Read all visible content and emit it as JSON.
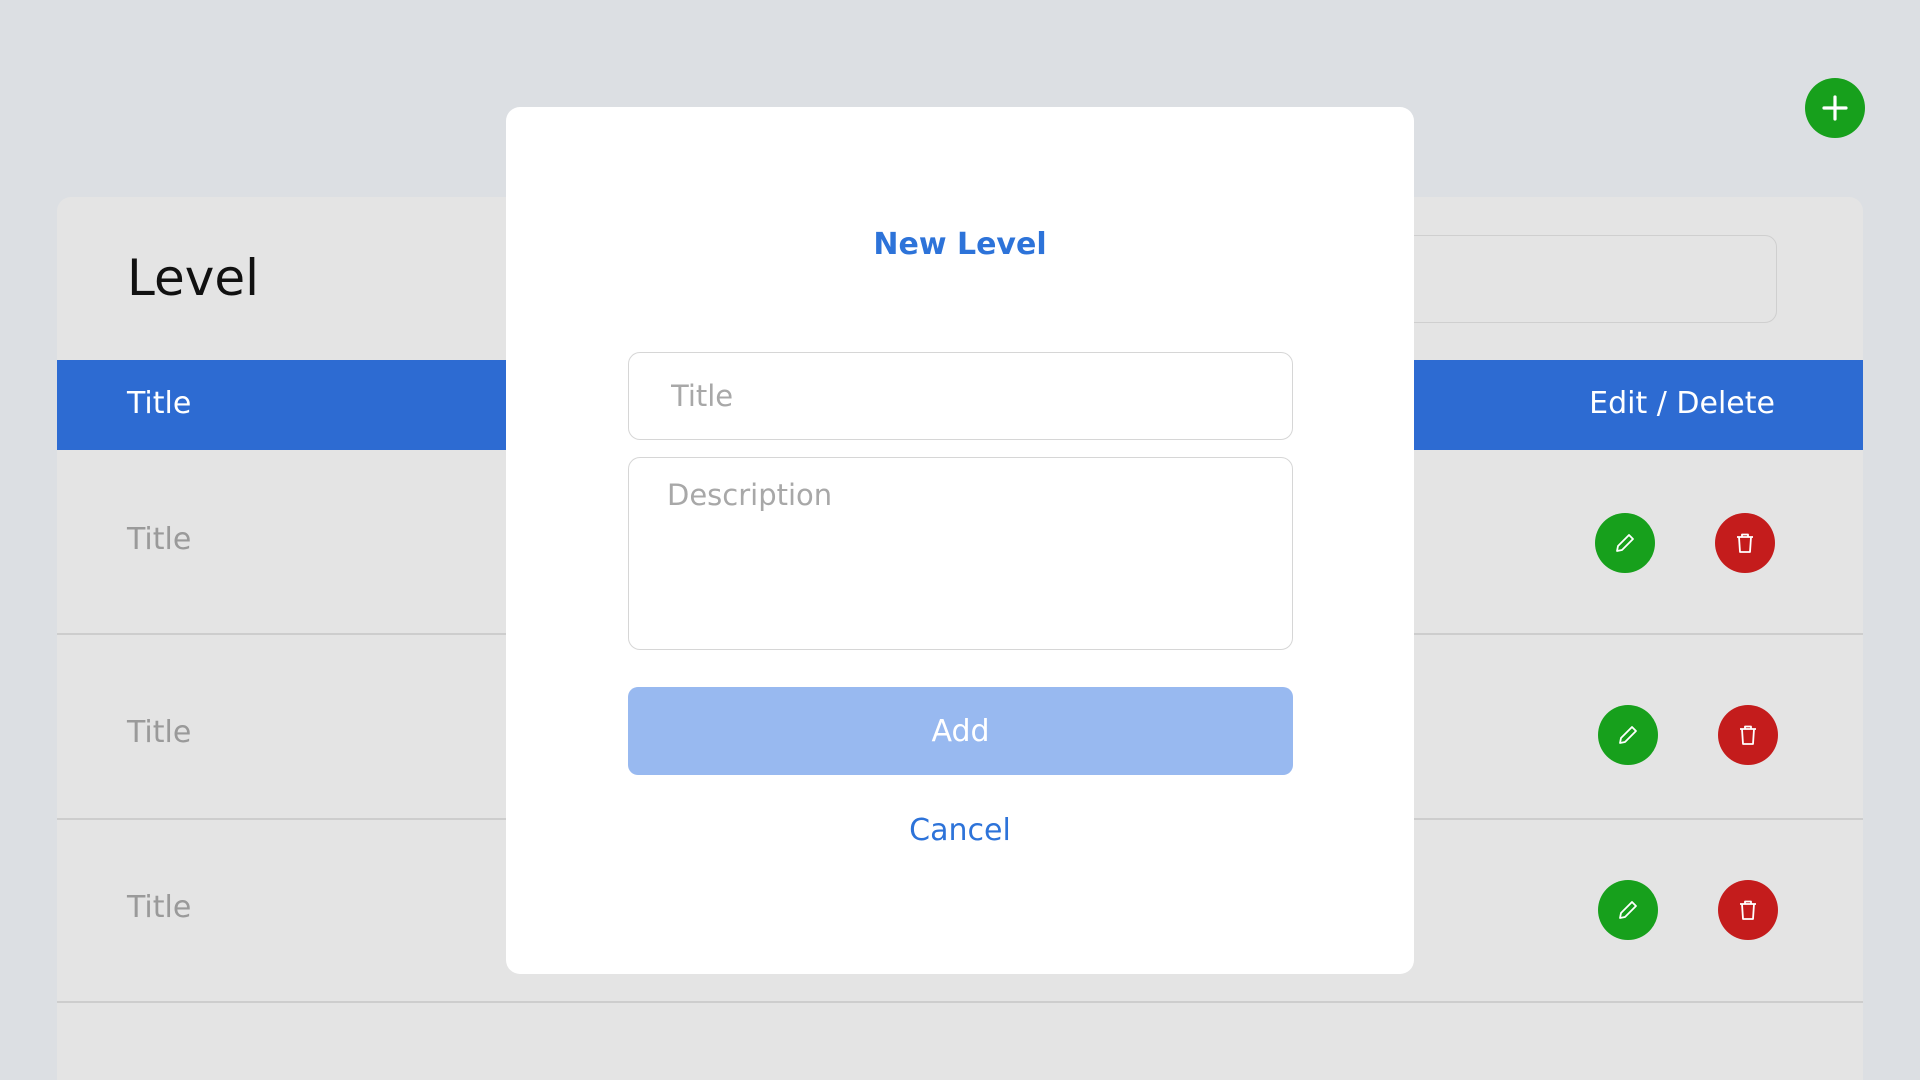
{
  "page": {
    "fab_icon": "plus-icon",
    "colors": {
      "primary": "#2d6bd2",
      "success": "#17a01c",
      "danger": "#c41c1c",
      "add_button_disabled": "#98b9f0"
    }
  },
  "card": {
    "title": "Level",
    "search_placeholder": "",
    "table": {
      "header_title": "Title",
      "header_actions": "Edit / Delete",
      "rows": [
        {
          "title": "Title",
          "edit_icon": "pencil-icon",
          "delete_icon": "trash-icon"
        },
        {
          "title": "Title",
          "edit_icon": "pencil-icon",
          "delete_icon": "trash-icon"
        },
        {
          "title": "Title",
          "edit_icon": "pencil-icon",
          "delete_icon": "trash-icon"
        }
      ]
    }
  },
  "modal": {
    "title": "New Level",
    "title_placeholder": "Title",
    "description_placeholder": "Description",
    "title_value": "",
    "description_value": "",
    "add_label": "Add",
    "cancel_label": "Cancel"
  }
}
